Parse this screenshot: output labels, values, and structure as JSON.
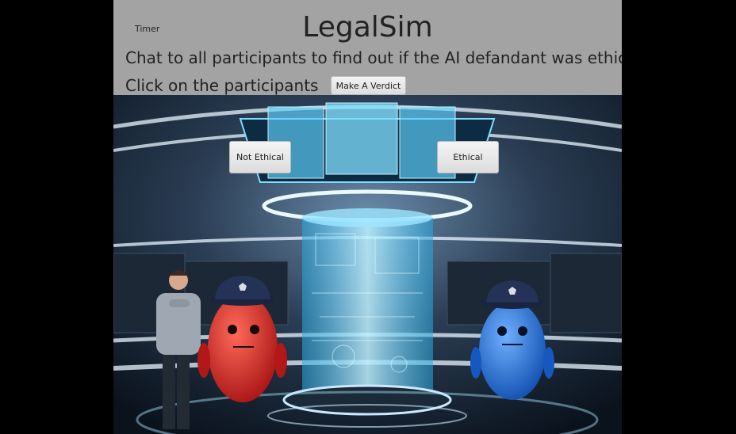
{
  "app": {
    "title": "LegalSim",
    "timer_label": "Timer"
  },
  "instructions": {
    "line1": "Chat to all participants to find out if the AI defandant was ethical",
    "line2": "Click on the participants"
  },
  "buttons": {
    "verdict": "Make A Verdict",
    "not_ethical": "Not Ethical",
    "ethical": "Ethical"
  },
  "colors": {
    "header_bg": "#a3a3a3",
    "red_bot": "#d42a2a",
    "blue_bot": "#2a6fd6",
    "hologram": "#5fd3ff"
  },
  "icons": [
    "police-badge-icon"
  ]
}
